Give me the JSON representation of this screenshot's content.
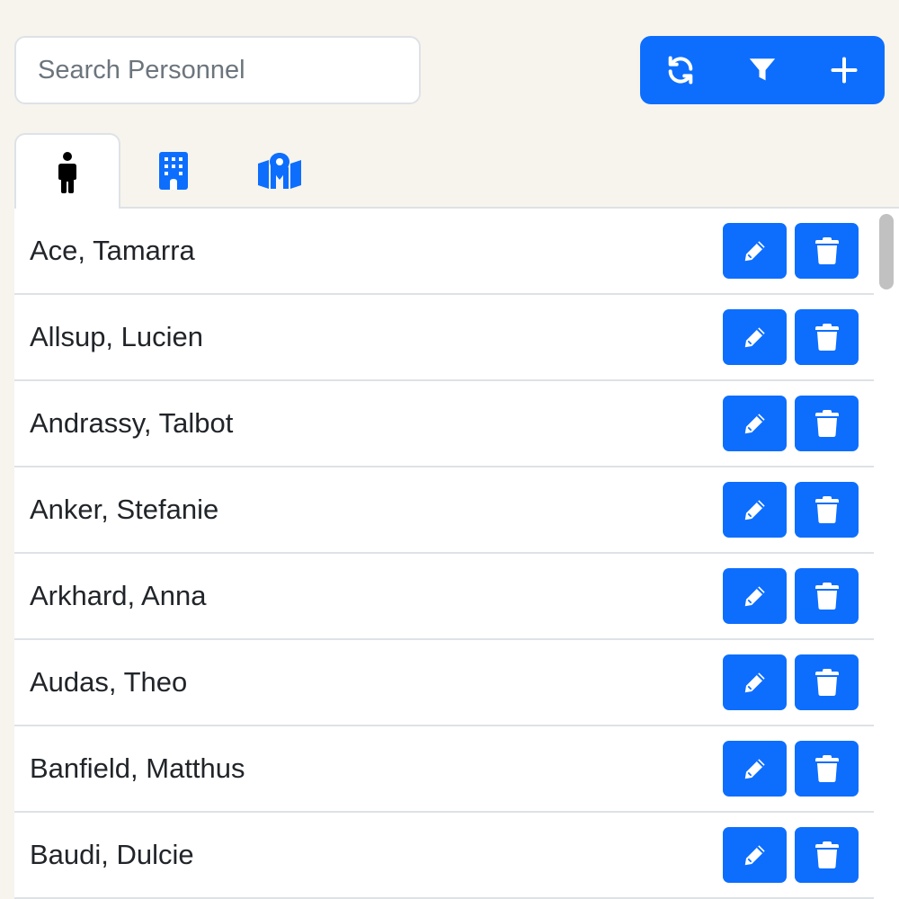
{
  "search": {
    "placeholder": "Search Personnel",
    "value": ""
  },
  "toolbar": {
    "buttons": [
      {
        "icon": "refresh-icon"
      },
      {
        "icon": "filter-icon"
      },
      {
        "icon": "plus-icon"
      }
    ]
  },
  "tabs": [
    {
      "icon": "person-icon",
      "active": true
    },
    {
      "icon": "building-icon",
      "active": false
    },
    {
      "icon": "map-location-icon",
      "active": false
    }
  ],
  "personnel": [
    {
      "name": "Ace, Tamarra"
    },
    {
      "name": "Allsup, Lucien"
    },
    {
      "name": "Andrassy, Talbot"
    },
    {
      "name": "Anker, Stefanie"
    },
    {
      "name": "Arkhard, Anna"
    },
    {
      "name": "Audas, Theo"
    },
    {
      "name": "Banfield, Matthus"
    },
    {
      "name": "Baudi, Dulcie"
    }
  ],
  "colors": {
    "accent": "#0d6efd",
    "background": "#f7f4ee",
    "border": "#dee2e6",
    "text": "#212529"
  }
}
